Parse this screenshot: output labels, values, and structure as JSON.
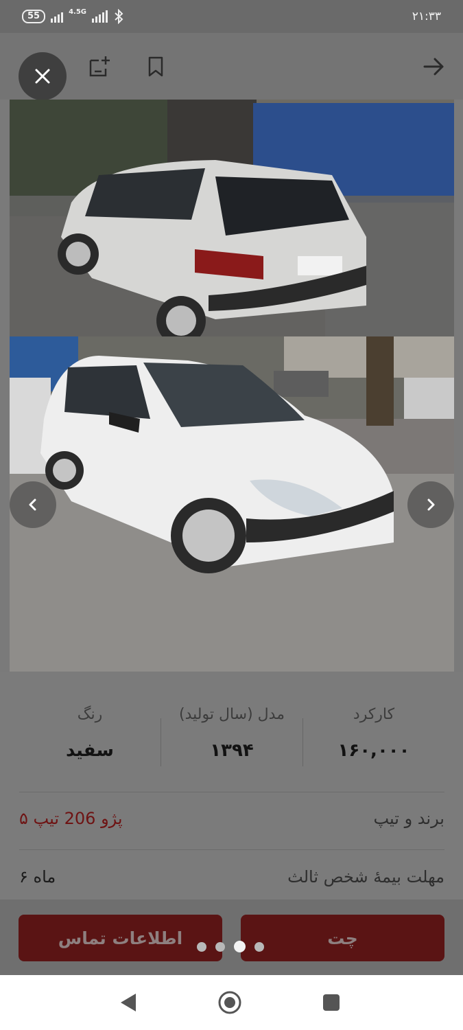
{
  "status_bar": {
    "time": "۲۱:۳۳",
    "battery": "55",
    "network": "4.5G"
  },
  "toolbar": {
    "icons": [
      "close-icon",
      "add-compare-icon",
      "bookmark-icon",
      "arrow-right-icon"
    ]
  },
  "gallery": {
    "pages": 4,
    "active_page": 3
  },
  "stats": {
    "mileage_label": "کارکرد",
    "mileage_value": "۱۶۰,۰۰۰",
    "model_label": "مدل (سال تولید)",
    "model_value": "۱۳۹۴",
    "color_label": "رنگ",
    "color_value": "سفید"
  },
  "details": {
    "brand_label": "برند و تیپ",
    "brand_value": "پژو 206 تیپ ۵",
    "insurance_label": "مهلت بیمهٔ شخص ثالث",
    "insurance_value": "۶ ماه"
  },
  "actions": {
    "contact_label": "اطلاعات تماس",
    "chat_label": "چت"
  },
  "colors": {
    "accent": "#5a1414",
    "brand_text": "#6e1313"
  }
}
